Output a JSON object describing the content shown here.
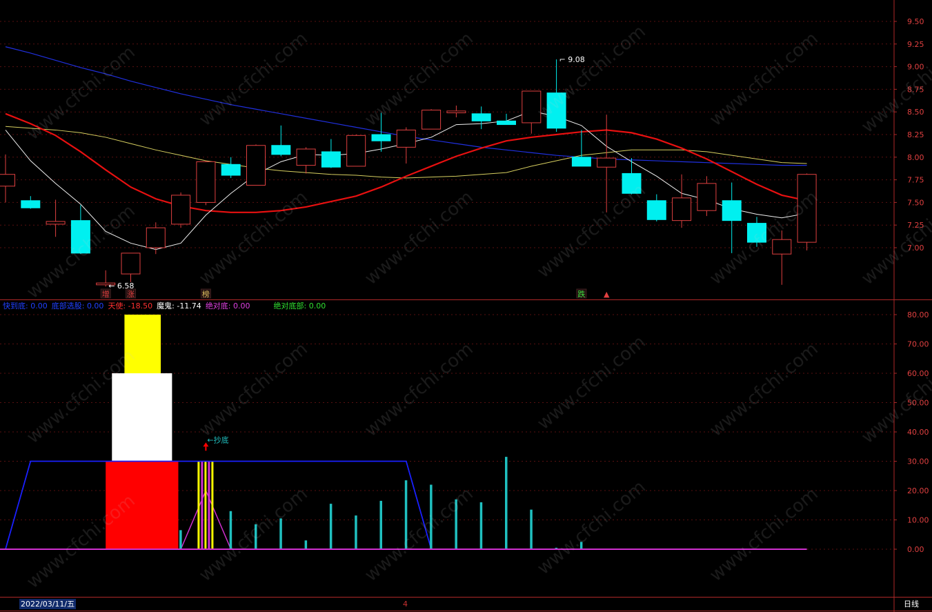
{
  "colors": {
    "background": "#000000",
    "axis": "#b02828",
    "grid": "#5a1010",
    "up": "#e04040",
    "down": "#00f0f0",
    "ma5": "#f0f0f0",
    "ma10": "#e81010",
    "ma20": "#d8d060",
    "ma60": "#2030e0",
    "ind_blue": "#1a20ff",
    "ind_magenta": "#d030d0",
    "ind_cyan": "#20c0c0",
    "ind_red": "#ff0000",
    "ind_white": "#ffffff",
    "ind_yellow": "#ffff00"
  },
  "chart_data": [
    {
      "type": "candlestick",
      "ylim": [
        6.6,
        9.6
      ],
      "y_ticks": [
        "9.50",
        "9.25",
        "9.00",
        "8.75",
        "8.50",
        "8.25",
        "8.00",
        "7.75",
        "7.50",
        "7.25",
        "7.00"
      ],
      "candles": [
        {
          "o": 7.68,
          "h": 8.03,
          "l": 7.5,
          "c": 7.81
        },
        {
          "o": 7.52,
          "h": 7.57,
          "l": 7.43,
          "c": 7.44
        },
        {
          "o": 7.26,
          "h": 7.53,
          "l": 7.12,
          "c": 7.29
        },
        {
          "o": 7.3,
          "h": 7.47,
          "l": 6.93,
          "c": 6.94
        },
        {
          "o": 6.59,
          "h": 6.75,
          "l": 6.57,
          "c": 6.61
        },
        {
          "o": 6.71,
          "h": 6.94,
          "l": 6.62,
          "c": 6.94
        },
        {
          "o": 7.0,
          "h": 7.28,
          "l": 6.93,
          "c": 7.22
        },
        {
          "o": 7.26,
          "h": 7.61,
          "l": 7.22,
          "c": 7.58
        },
        {
          "o": 7.5,
          "h": 7.96,
          "l": 7.47,
          "c": 7.95
        },
        {
          "o": 7.92,
          "h": 8.0,
          "l": 7.77,
          "c": 7.8
        },
        {
          "o": 7.69,
          "h": 8.14,
          "l": 7.69,
          "c": 8.13
        },
        {
          "o": 8.13,
          "h": 8.35,
          "l": 8.01,
          "c": 8.03
        },
        {
          "o": 7.91,
          "h": 8.11,
          "l": 7.82,
          "c": 8.09
        },
        {
          "o": 8.06,
          "h": 8.2,
          "l": 7.88,
          "c": 7.89
        },
        {
          "o": 7.9,
          "h": 8.25,
          "l": 7.9,
          "c": 8.24
        },
        {
          "o": 8.25,
          "h": 8.49,
          "l": 8.06,
          "c": 8.18
        },
        {
          "o": 8.11,
          "h": 8.33,
          "l": 7.93,
          "c": 8.3
        },
        {
          "o": 8.31,
          "h": 8.53,
          "l": 8.31,
          "c": 8.52
        },
        {
          "o": 8.49,
          "h": 8.57,
          "l": 8.44,
          "c": 8.51
        },
        {
          "o": 8.48,
          "h": 8.56,
          "l": 8.31,
          "c": 8.4
        },
        {
          "o": 8.4,
          "h": 8.48,
          "l": 8.36,
          "c": 8.36
        },
        {
          "o": 8.38,
          "h": 8.67,
          "l": 8.26,
          "c": 8.73
        },
        {
          "o": 8.71,
          "h": 9.08,
          "l": 8.28,
          "c": 8.32
        },
        {
          "o": 8.0,
          "h": 8.3,
          "l": 7.92,
          "c": 7.9
        },
        {
          "o": 7.89,
          "h": 8.47,
          "l": 7.39,
          "c": 7.99
        },
        {
          "o": 7.82,
          "h": 7.99,
          "l": 7.59,
          "c": 7.6
        },
        {
          "o": 7.52,
          "h": 7.59,
          "l": 7.29,
          "c": 7.31
        },
        {
          "o": 7.3,
          "h": 7.81,
          "l": 7.22,
          "c": 7.55
        },
        {
          "o": 7.41,
          "h": 7.79,
          "l": 7.35,
          "c": 7.71
        },
        {
          "o": 7.52,
          "h": 7.72,
          "l": 6.94,
          "c": 7.3
        },
        {
          "o": 7.27,
          "h": 7.34,
          "l": 7.01,
          "c": 7.06
        },
        {
          "o": 6.93,
          "h": 7.19,
          "l": 6.59,
          "c": 7.09
        },
        {
          "o": 7.06,
          "h": 7.82,
          "l": 6.97,
          "c": 7.81
        }
      ],
      "ma5": [
        8.3,
        7.96,
        7.71,
        7.48,
        7.18,
        7.05,
        6.98,
        7.05,
        7.36,
        7.6,
        7.81,
        7.95,
        8.03,
        8.02,
        8.04,
        8.09,
        8.15,
        8.22,
        8.36,
        8.37,
        8.4,
        8.51,
        8.45,
        8.35,
        8.12,
        7.95,
        7.79,
        7.6,
        7.53,
        7.43,
        7.37,
        7.33,
        7.38
      ],
      "ma10": [
        8.48,
        8.37,
        8.24,
        8.06,
        7.86,
        7.67,
        7.54,
        7.46,
        7.41,
        7.39,
        7.39,
        7.41,
        7.45,
        7.51,
        7.57,
        7.67,
        7.79,
        7.9,
        8.01,
        8.1,
        8.18,
        8.22,
        8.25,
        8.28,
        8.3,
        8.27,
        8.2,
        8.1,
        7.98,
        7.84,
        7.7,
        7.58,
        7.52
      ],
      "ma20": [
        8.34,
        8.32,
        8.3,
        8.27,
        8.22,
        8.15,
        8.08,
        8.02,
        7.96,
        7.92,
        7.88,
        7.85,
        7.83,
        7.81,
        7.8,
        7.78,
        7.77,
        7.78,
        7.79,
        7.81,
        7.83,
        7.9,
        7.96,
        8.02,
        8.05,
        8.08,
        8.08,
        8.08,
        8.06,
        8.02,
        7.98,
        7.94,
        7.93
      ],
      "ma60": [
        9.22,
        9.15,
        9.07,
        8.99,
        8.92,
        8.84,
        8.77,
        8.7,
        8.64,
        8.58,
        8.53,
        8.48,
        8.43,
        8.38,
        8.33,
        8.28,
        8.23,
        8.19,
        8.15,
        8.11,
        8.08,
        8.05,
        8.02,
        8.0,
        7.98,
        7.97,
        7.96,
        7.95,
        7.94,
        7.93,
        7.92,
        7.91,
        7.91
      ],
      "annotations": [
        {
          "text": "9.08",
          "at_candle": 22,
          "price": 9.08
        },
        {
          "text": "6.58",
          "at_candle": 4,
          "price": 6.58
        }
      ],
      "bottom_tags": [
        {
          "text": "增",
          "at_candle": 4,
          "color": "#e04040",
          "boxed": true
        },
        {
          "text": "涨",
          "at_candle": 5,
          "color": "#e04040",
          "boxed": true
        },
        {
          "text": "榜",
          "at_candle": 8,
          "color": "#e0c060",
          "boxed": true
        },
        {
          "text": "跌",
          "at_candle": 23,
          "color": "#40e040",
          "boxed": true
        },
        {
          "text": "▲",
          "at_candle": 24,
          "color": "#e04040",
          "boxed": false
        }
      ]
    },
    {
      "type": "indicator",
      "ylim": [
        0,
        82
      ],
      "y_ticks": [
        "80.00",
        "70.00",
        "60.00",
        "50.00",
        "40.00",
        "30.00",
        "20.00",
        "10.00",
        "0.00"
      ],
      "legend": [
        {
          "label": "快到底:",
          "value": "0.00",
          "color": "#2040ff"
        },
        {
          "label": "底部选股:",
          "value": "0.00",
          "color": "#2040ff"
        },
        {
          "label": "天使:",
          "value": "-18.50",
          "color": "#ff3030"
        },
        {
          "label": "魔鬼:",
          "value": "-11.74",
          "color": "#ffffff"
        },
        {
          "label": "绝对底:",
          "value": "0.00",
          "color": "#e040e0"
        },
        {
          "label": "绝对底部:",
          "value": "0.00",
          "color": "#30e030"
        }
      ],
      "blue_trapezoid": [
        [
          0.0,
          0
        ],
        [
          1.0,
          30
        ],
        [
          16.0,
          30
        ],
        [
          17.0,
          0
        ]
      ],
      "blocks": [
        {
          "color": "red",
          "from_candle": 4.0,
          "to_candle": 6.9,
          "low": 0,
          "high": 30
        },
        {
          "color": "white",
          "from_candle": 4.25,
          "to_candle": 6.65,
          "low": 30,
          "high": 60
        },
        {
          "color": "yellow",
          "from_candle": 4.75,
          "to_candle": 6.2,
          "low": 60,
          "high": 80
        }
      ],
      "stripes_candle": 8,
      "magenta_triangle": [
        [
          7.0,
          0
        ],
        [
          8.0,
          20
        ],
        [
          9.0,
          0
        ]
      ],
      "cyan_bars": [
        {
          "at_candle": 7,
          "value": 6.5
        },
        {
          "at_candle": 9,
          "value": 13
        },
        {
          "at_candle": 10,
          "value": 8.5
        },
        {
          "at_candle": 11,
          "value": 10.5
        },
        {
          "at_candle": 12,
          "value": 3
        },
        {
          "at_candle": 13,
          "value": 15.5
        },
        {
          "at_candle": 14,
          "value": 11.5
        },
        {
          "at_candle": 15,
          "value": 16.5
        },
        {
          "at_candle": 16,
          "value": 23.5
        },
        {
          "at_candle": 17,
          "value": 22
        },
        {
          "at_candle": 18,
          "value": 17
        },
        {
          "at_candle": 19,
          "value": 16
        },
        {
          "at_candle": 20,
          "value": 31.5
        },
        {
          "at_candle": 21,
          "value": 13.5
        },
        {
          "at_candle": 22,
          "value": 0.5
        },
        {
          "at_candle": 23,
          "value": 2.5
        }
      ],
      "arrow_label": {
        "text": "←抄底",
        "at_candle": 8,
        "value": 35
      }
    }
  ],
  "footer": {
    "date": "2022/03/11/五",
    "page": "4",
    "period": "日线"
  },
  "watermark": "www.cfchi.com"
}
